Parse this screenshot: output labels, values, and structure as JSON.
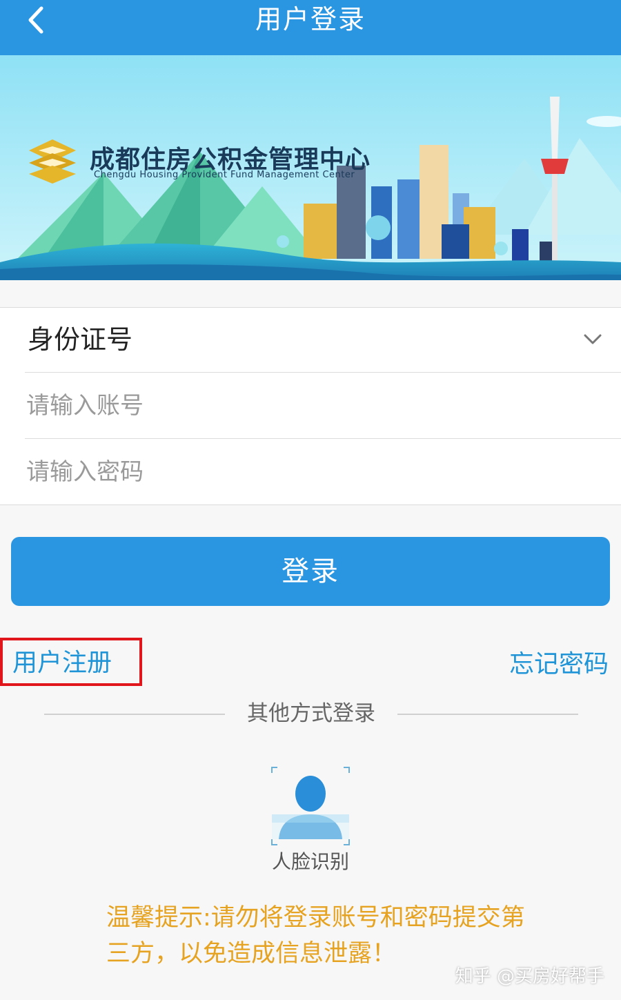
{
  "header": {
    "title": "用户登录",
    "back_icon": "back-arrow-icon"
  },
  "banner": {
    "org_name_cn": "成都住房公积金管理中心",
    "org_name_en": "Chengdu Housing Provident Fund Management Center",
    "logo_icon": "chengdu-hpf-logo-icon"
  },
  "form": {
    "id_type_selected": "身份证号",
    "account_placeholder": "请输入账号",
    "password_placeholder": "请输入密码",
    "account_value": "",
    "password_value": ""
  },
  "actions": {
    "login_label": "登录",
    "register_label": "用户注册",
    "forgot_label": "忘记密码"
  },
  "other_login": {
    "label": "其他方式登录",
    "face_label": "人脸识别"
  },
  "tip": {
    "text": "温馨提示:请勿将登录账号和密码提交第三方，以免造成信息泄露！"
  },
  "watermark": {
    "text": "知乎 @买房好帮手"
  },
  "colors": {
    "primary": "#2a96e2",
    "link": "#1f95d8",
    "tip": "#e6a321",
    "highlight_border": "#e0161c"
  }
}
